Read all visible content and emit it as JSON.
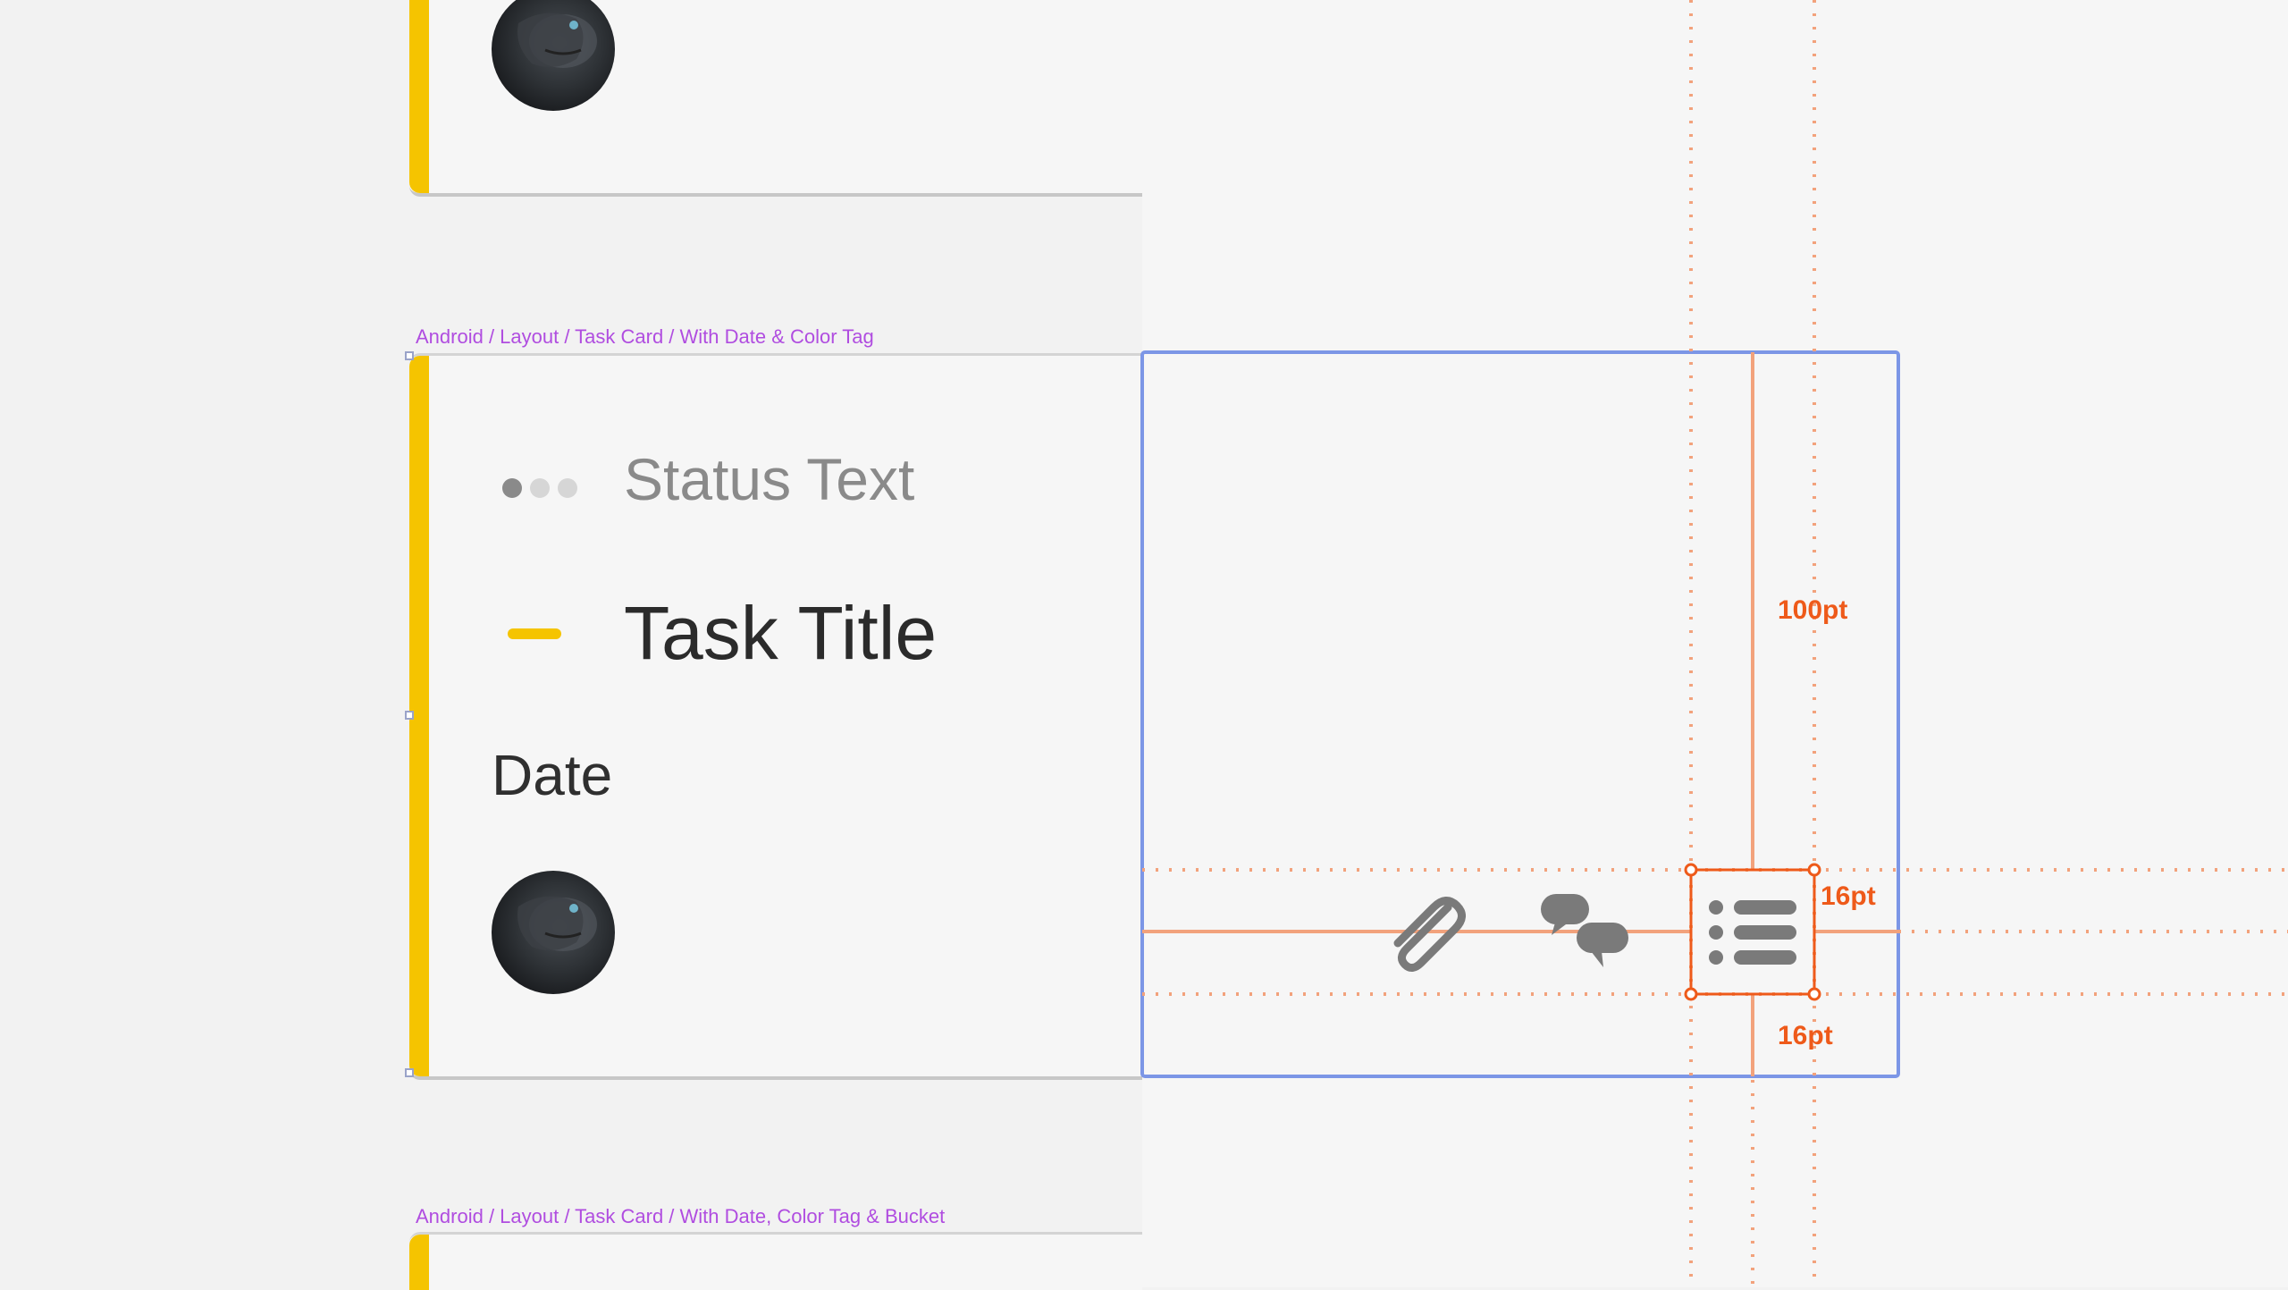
{
  "frames": [
    {
      "label": "Android / Layout / Task Card / With Date & Color Tag"
    },
    {
      "label": "Android / Layout / Task Card / With Date, Color Tag & Bucket"
    }
  ],
  "card": {
    "status_text": "Status Text",
    "task_title": "Task Title",
    "date": "Date"
  },
  "measurements": {
    "height_label": "100pt",
    "icon_size_label": "16pt",
    "bottom_padding_label": "16pt"
  },
  "colors": {
    "tag": "#f5c400",
    "annotation": "#ee5a1a",
    "selection": "#7c96e6",
    "frame_label": "#b04de0"
  },
  "icons": [
    "paperclip-icon",
    "comments-icon",
    "checklist-icon"
  ]
}
